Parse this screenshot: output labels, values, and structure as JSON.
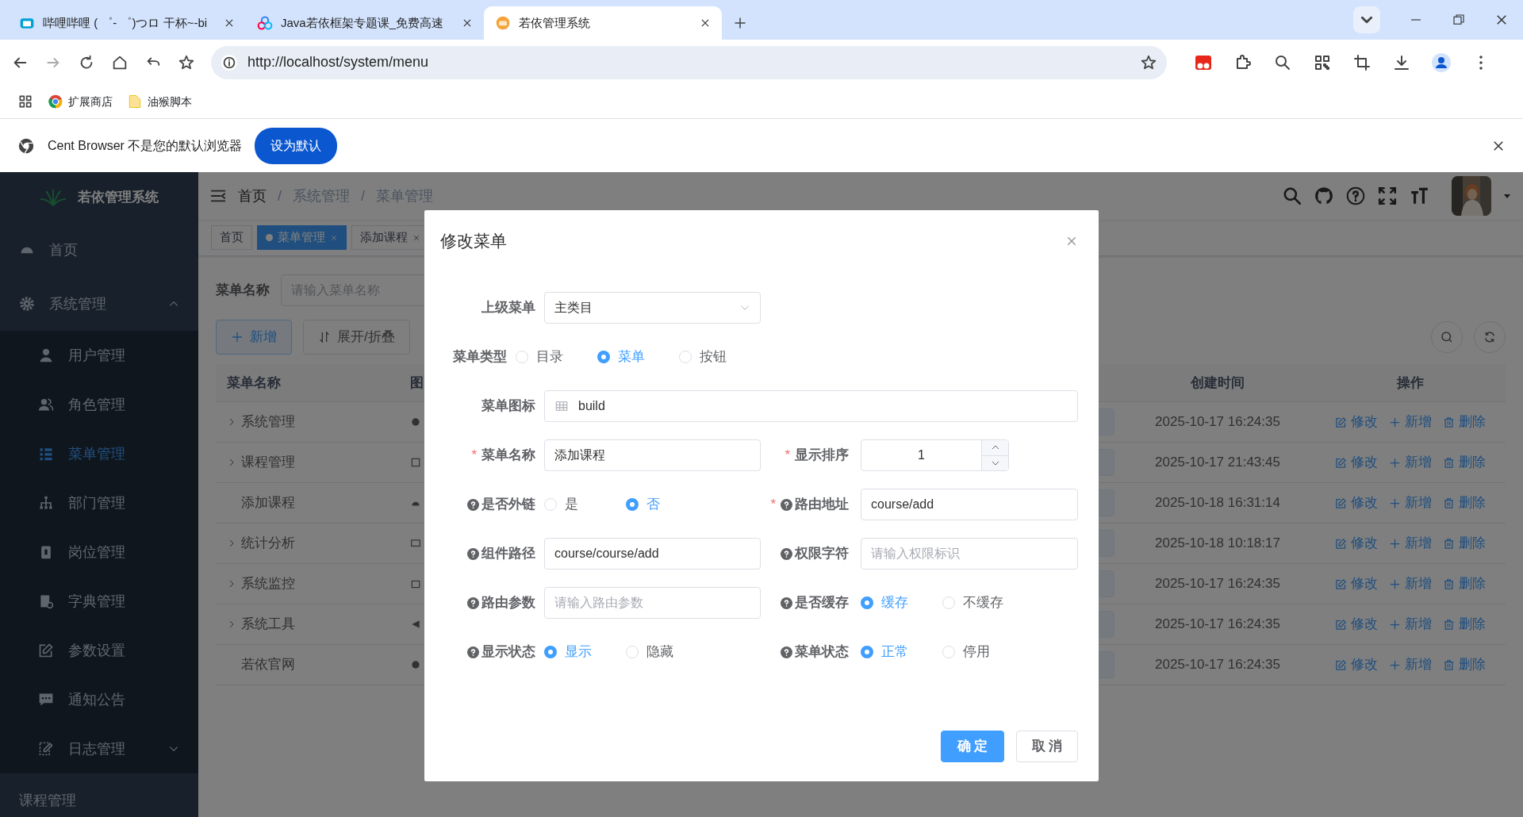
{
  "browser": {
    "tabs": [
      {
        "title": "哔哩哔哩 ( ゜- ゜)つロ 干杯~-bi",
        "selected": false
      },
      {
        "title": "Java若依框架专题课_免费高速",
        "selected": false
      },
      {
        "title": "若依管理系统",
        "selected": true
      }
    ],
    "address": "http://localhost/system/menu",
    "bookmarks": [
      "扩展商店",
      "油猴脚本"
    ],
    "infobar": {
      "message": "Cent Browser 不是您的默认浏览器",
      "button": "设为默认"
    }
  },
  "app": {
    "logo_title": "若依管理系统",
    "sidebar": [
      {
        "label": "首页",
        "selected": false
      },
      {
        "label": "系统管理",
        "selected": false,
        "expanded": true,
        "children": [
          {
            "label": "用户管理",
            "selected": false
          },
          {
            "label": "角色管理",
            "selected": false
          },
          {
            "label": "菜单管理",
            "selected": true
          },
          {
            "label": "部门管理",
            "selected": false
          },
          {
            "label": "岗位管理",
            "selected": false
          },
          {
            "label": "字典管理",
            "selected": false
          },
          {
            "label": "参数设置",
            "selected": false
          },
          {
            "label": "通知公告",
            "selected": false
          },
          {
            "label": "日志管理",
            "selected": false,
            "expanded": false
          }
        ]
      },
      {
        "label": "课程管理",
        "selected": false
      }
    ],
    "breadcrumb": [
      {
        "label": "首页"
      },
      {
        "separator": "/",
        "label": "系统管理"
      },
      {
        "separator": "/",
        "label": "菜单管理"
      }
    ],
    "tags": [
      {
        "label": "首页",
        "selected": false
      },
      {
        "label": "菜单管理",
        "selected": true
      },
      {
        "label": "添加课程",
        "selected": false
      }
    ],
    "search": {
      "label": "菜单名称",
      "placeholder": "请输入菜单名称"
    },
    "toolbar": [
      "新增",
      "展开/折叠"
    ],
    "table": {
      "columns": [
        "菜单名称",
        "图",
        "创建时间",
        "操作"
      ],
      "rows": [
        {
          "name": "系统管理",
          "expandable": true,
          "created": "2025-10-17 16:24:35",
          "actions": [
            "修改",
            "新增",
            "删除"
          ]
        },
        {
          "name": "课程管理",
          "expandable": true,
          "created": "2025-10-17 21:43:45",
          "actions": [
            "修改",
            "新增",
            "删除"
          ]
        },
        {
          "name": "添加课程",
          "expandable": false,
          "created": "2025-10-18 16:31:14",
          "actions": [
            "修改",
            "新增",
            "删除"
          ]
        },
        {
          "name": "统计分析",
          "expandable": true,
          "created": "2025-10-18 10:18:17",
          "actions": [
            "修改",
            "新增",
            "删除"
          ]
        },
        {
          "name": "系统监控",
          "expandable": true,
          "created": "2025-10-17 16:24:35",
          "actions": [
            "修改",
            "新增",
            "删除"
          ]
        },
        {
          "name": "系统工具",
          "expandable": true,
          "created": "2025-10-17 16:24:35",
          "actions": [
            "修改",
            "新增",
            "删除"
          ]
        },
        {
          "name": "若依官网",
          "expandable": false,
          "created": "2025-10-17 16:24:35",
          "actions": [
            "修改",
            "新增",
            "删除"
          ]
        }
      ]
    }
  },
  "dialog": {
    "title": "修改菜单",
    "rows": [
      [
        {
          "label": "上级菜单",
          "kind": "select",
          "help": false,
          "value": "主类目"
        }
      ],
      [
        {
          "label": "菜单类型",
          "kind": "radio",
          "help": false,
          "options": [
            {
              "label": "目录",
              "selected": false
            },
            {
              "label": "菜单",
              "selected": true
            },
            {
              "label": "按钮",
              "selected": false
            }
          ]
        }
      ],
      [
        {
          "label": "菜单图标",
          "kind": "icon-input",
          "help": false,
          "value": "build"
        }
      ],
      [
        {
          "label": "菜单名称",
          "kind": "text",
          "required_mark": "*",
          "help": false,
          "value": "添加课程"
        },
        {
          "label": "显示排序",
          "kind": "number",
          "required_mark": "*",
          "help": false,
          "value": "1"
        }
      ],
      [
        {
          "label": "是否外链",
          "kind": "radio",
          "help": true,
          "options": [
            {
              "label": "是",
              "selected": false
            },
            {
              "label": "否",
              "selected": true
            }
          ]
        },
        {
          "label": "路由地址",
          "kind": "text",
          "required_mark": "*",
          "help": true,
          "value": "course/add"
        }
      ],
      [
        {
          "label": "组件路径",
          "kind": "text",
          "help": true,
          "value": "course/course/add"
        },
        {
          "label": "权限字符",
          "kind": "text",
          "help": true,
          "placeholder": "请输入权限标识"
        }
      ],
      [
        {
          "label": "路由参数",
          "kind": "text",
          "help": true,
          "placeholder": "请输入路由参数"
        },
        {
          "label": "是否缓存",
          "kind": "radio",
          "help": true,
          "options": [
            {
              "label": "缓存",
              "selected": true
            },
            {
              "label": "不缓存",
              "selected": false
            }
          ]
        }
      ],
      [
        {
          "label": "显示状态",
          "kind": "radio",
          "help": true,
          "options": [
            {
              "label": "显示",
              "selected": true
            },
            {
              "label": "隐藏",
              "selected": false
            }
          ]
        },
        {
          "label": "菜单状态",
          "kind": "radio",
          "help": true,
          "options": [
            {
              "label": "正常",
              "selected": true
            },
            {
              "label": "停用",
              "selected": false
            }
          ]
        }
      ]
    ],
    "buttons": [
      {
        "label": "确 定",
        "kind": "primary"
      },
      {
        "label": "取 消",
        "kind": "default"
      }
    ]
  }
}
